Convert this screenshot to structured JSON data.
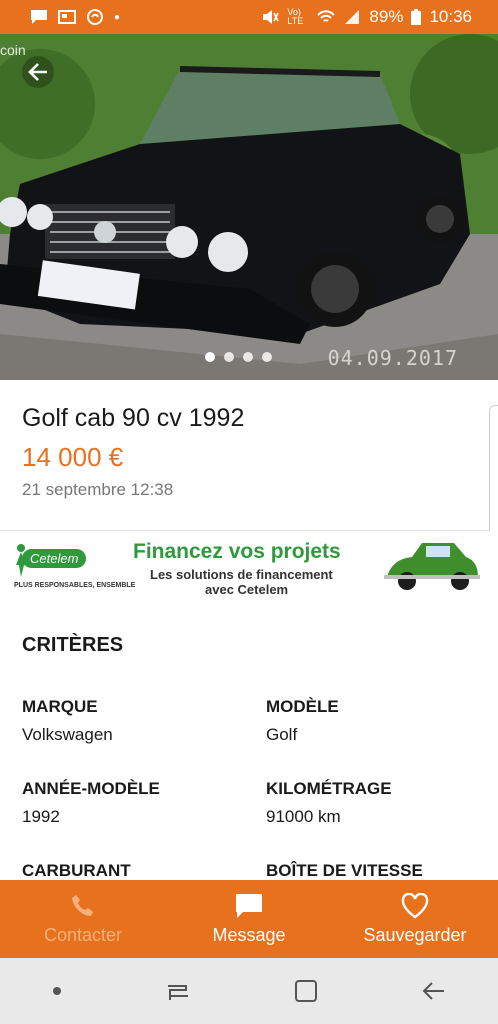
{
  "status_bar": {
    "battery": "89%",
    "time": "10:36",
    "volte": "Vo) LTE"
  },
  "hero": {
    "partial_tag": "coin",
    "photo_date": "04.09.2017",
    "photo_count": 4,
    "current_photo": 1
  },
  "ad": {
    "title": "Golf cab 90 cv 1992",
    "price": "14 000 €",
    "date": "21 septembre 12:38"
  },
  "banner": {
    "brand": "Cetelem",
    "tagline": "PLUS RESPONSABLES, ENSEMBLE",
    "title": "Financez vos projets",
    "sub1": "Les solutions de financement",
    "sub2": "avec Cetelem"
  },
  "criteria": {
    "heading": "CRITÈRES",
    "items": [
      {
        "label": "MARQUE",
        "value": "Volkswagen"
      },
      {
        "label": "MODÈLE",
        "value": "Golf"
      },
      {
        "label": "ANNÉE-MODÈLE",
        "value": "1992"
      },
      {
        "label": "KILOMÉTRAGE",
        "value": "91000 km"
      },
      {
        "label": "CARBURANT",
        "value": ""
      },
      {
        "label": "BOÎTE DE VITESSE",
        "value": ""
      }
    ]
  },
  "actions": {
    "contact": "Contacter",
    "message": "Message",
    "save": "Sauvegarder"
  },
  "colors": {
    "brand": "#e8711d",
    "cetelem_green": "#2f9a3b"
  }
}
